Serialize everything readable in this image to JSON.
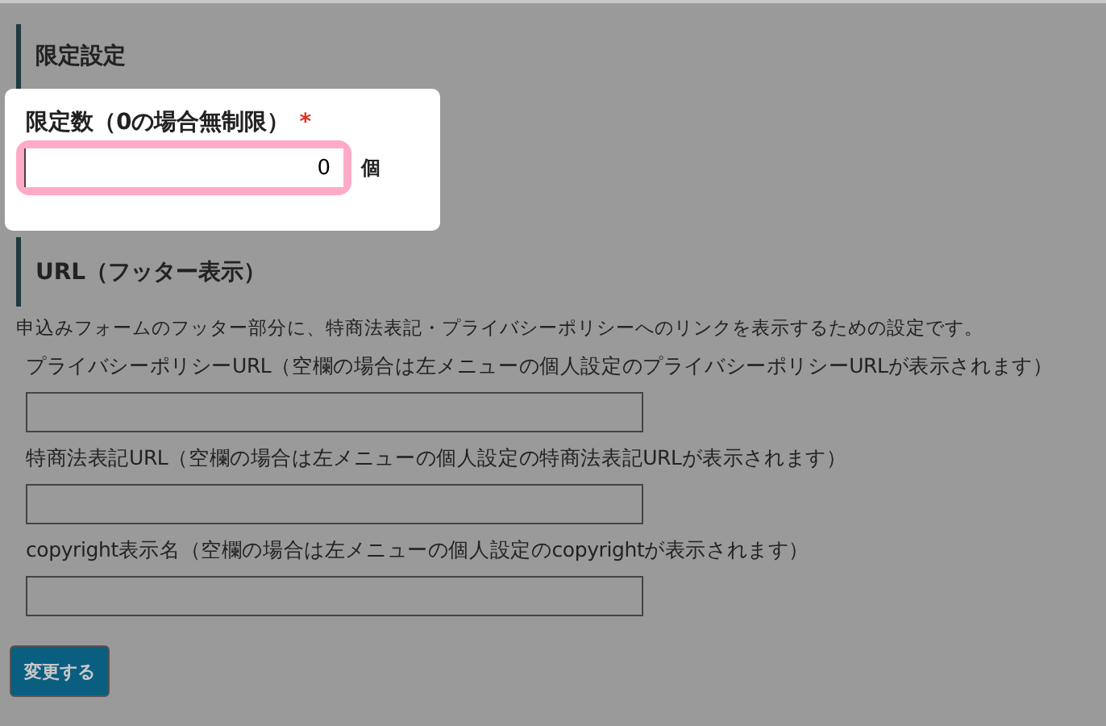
{
  "limit_section": {
    "heading": "限定設定",
    "field": {
      "label": "限定数（0の場合無制限）",
      "required_mark": "*",
      "value": "0",
      "unit": "個"
    }
  },
  "url_section": {
    "heading": "URL（フッター表示）",
    "description": "申込みフォームのフッター部分に、特商法表記・プライバシーポリシーへのリンクを表示するための設定です。",
    "fields": [
      {
        "label": "プライバシーポリシーURL（空欄の場合は左メニューの個人設定のプライバシーポリシーURLが表示されます）"
      },
      {
        "label": "特商法表記URL（空欄の場合は左メニューの個人設定の特商法表記URLが表示されます）"
      },
      {
        "label": "copyright表示名（空欄の場合は左メニューの個人設定のcopyrightが表示されます）"
      }
    ]
  },
  "submit_button": "変更する"
}
